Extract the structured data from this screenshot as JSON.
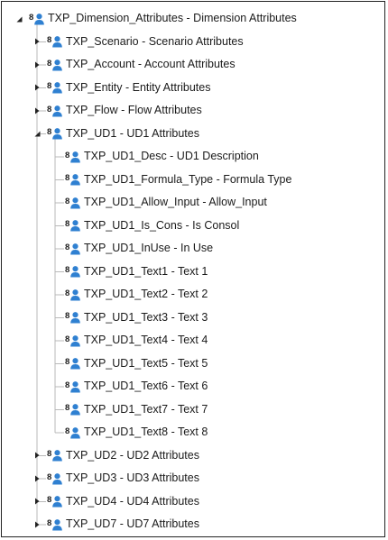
{
  "tree": {
    "root": {
      "label": "TXP_Dimension_Attributes - Dimension Attributes",
      "expanded": true,
      "children": [
        {
          "label": "TXP_Scenario - Scenario Attributes",
          "expanded": false
        },
        {
          "label": "TXP_Account - Account Attributes",
          "expanded": false
        },
        {
          "label": "TXP_Entity - Entity Attributes",
          "expanded": false
        },
        {
          "label": "TXP_Flow - Flow Attributes",
          "expanded": false
        },
        {
          "label": "TXP_UD1 - UD1 Attributes",
          "expanded": true,
          "children": [
            {
              "label": "TXP_UD1_Desc - UD1 Description"
            },
            {
              "label": "TXP_UD1_Formula_Type - Formula Type"
            },
            {
              "label": "TXP_UD1_Allow_Input - Allow_Input"
            },
            {
              "label": "TXP_UD1_Is_Cons - Is Consol"
            },
            {
              "label": "TXP_UD1_InUse - In Use"
            },
            {
              "label": "TXP_UD1_Text1 - Text 1"
            },
            {
              "label": "TXP_UD1_Text2 - Text 2"
            },
            {
              "label": "TXP_UD1_Text3 - Text 3"
            },
            {
              "label": "TXP_UD1_Text4 - Text 4"
            },
            {
              "label": "TXP_UD1_Text5 - Text 5"
            },
            {
              "label": "TXP_UD1_Text6 - Text 6"
            },
            {
              "label": "TXP_UD1_Text7 - Text 7"
            },
            {
              "label": "TXP_UD1_Text8 - Text 8"
            }
          ]
        },
        {
          "label": "TXP_UD2 - UD2 Attributes",
          "expanded": false
        },
        {
          "label": "TXP_UD3 - UD3 Attributes",
          "expanded": false
        },
        {
          "label": "TXP_UD4 - UD4 Attributes",
          "expanded": false
        },
        {
          "label": "TXP_UD7 - UD7 Attributes",
          "expanded": false
        }
      ]
    },
    "node_icon": "dimension-member-icon",
    "colors": {
      "text": "#1a1a1a",
      "icon_black": "#1c1c1c",
      "icon_blue": "#2f80d1",
      "guide_line": "#b9b9b9",
      "border": "#222222"
    }
  }
}
